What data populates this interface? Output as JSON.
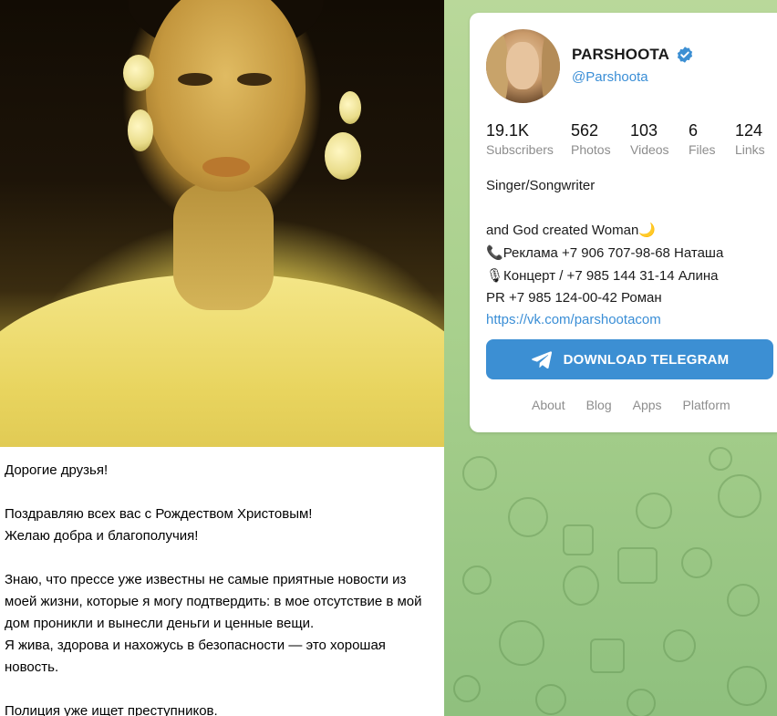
{
  "post": {
    "paragraphs": [
      "Дорогие друзья!",
      "Поздравляю всех вас с Рождеством Христовым!\nЖелаю добра и благополучия!",
      "Знаю, что прессе уже известны не самые приятные новости из моей жизни, которые я могу подтвердить: в мое отсутствие в мой дом проникли и вынесли деньги и ценные вещи.\nЯ жива, здорова и нахожусь в безопасности — это хорошая новость.",
      "Полиция уже ищет преступников."
    ]
  },
  "channel": {
    "name": "PARSHOOTA",
    "handle": "@Parshoota",
    "verified_icon": "verified-badge-icon",
    "stats": {
      "subscribers": {
        "value": "19.1K",
        "label": "Subscribers"
      },
      "photos": {
        "value": "562",
        "label": "Photos"
      },
      "videos": {
        "value": "103",
        "label": "Videos"
      },
      "files": {
        "value": "6",
        "label": "Files"
      },
      "links": {
        "value": "124",
        "label": "Links"
      }
    },
    "description": {
      "line1": "Singer/Songwriter",
      "line2_text": "and God created Woman",
      "line2_emoji": "🌙",
      "line3_emoji": "📞",
      "line3_text": "Реклама +7 906 707-98-68 Наташа",
      "line4_emoji": "🎙",
      "line4_text": "Концерт / +7 985 144 31-14 Алина",
      "line5": "PR +7 985 124-00-42 Роман",
      "link": "https://vk.com/parshootacom"
    }
  },
  "download_button": {
    "label": "DOWNLOAD TELEGRAM",
    "icon": "telegram-plane-icon"
  },
  "footer": {
    "about": "About",
    "blog": "Blog",
    "apps": "Apps",
    "platform": "Platform"
  },
  "colors": {
    "accent": "#3c8fd3",
    "link": "#3a8ed6",
    "background_pattern": "#a7cf8c",
    "muted_text": "#8d8d8d"
  }
}
